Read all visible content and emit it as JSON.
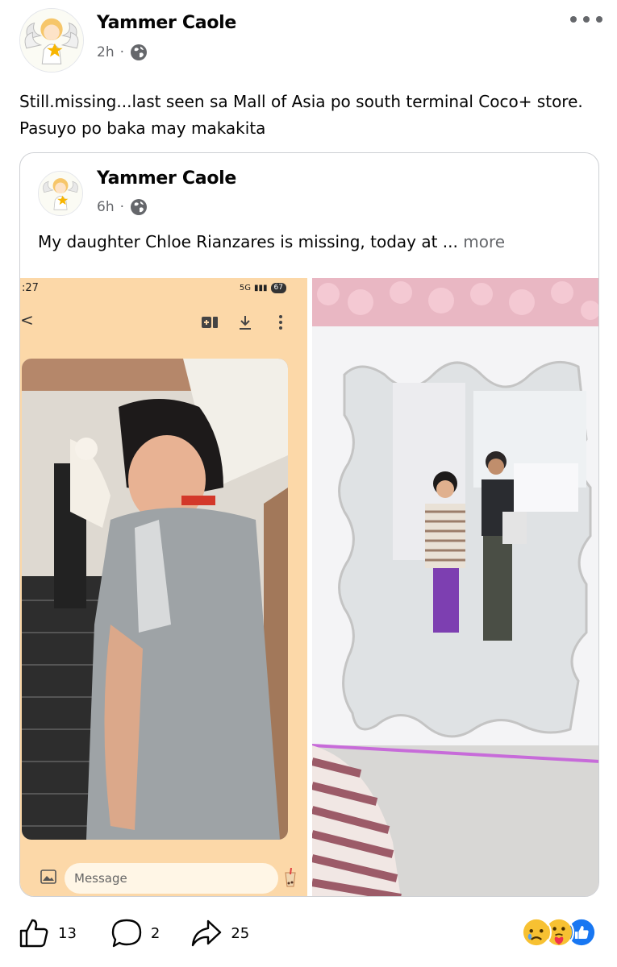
{
  "post": {
    "author": "Yammer Caole",
    "time": "2h",
    "privacy_icon": "globe-icon",
    "separator": "·",
    "text": "Still.missing...last seen sa Mall of Asia  po south terminal Coco+ store. Pasuyo po baka may makakita"
  },
  "shared_post": {
    "author": "Yammer Caole",
    "time": "6h",
    "separator": "·",
    "privacy_icon": "globe-icon",
    "text": "My daughter Chloe Rianzares is missing, today at ...",
    "more_label": "more",
    "photos": [
      {
        "kind": "phone-screenshot",
        "status_time": ":27",
        "status_network": "5G",
        "battery": "67",
        "back_glyph": "<",
        "message_placeholder": "Message"
      },
      {
        "kind": "mirror-photo"
      }
    ]
  },
  "actions": {
    "like_count": "13",
    "comment_count": "2",
    "share_count": "25"
  },
  "reactions": [
    "sad-reaction-icon",
    "care-reaction-icon",
    "like-reaction-icon"
  ],
  "colors": {
    "text": "#050505",
    "secondary": "#65676b",
    "border": "#ced0d4",
    "like_blue": "#1877f2",
    "phone_bg": "#fcd8a8"
  }
}
